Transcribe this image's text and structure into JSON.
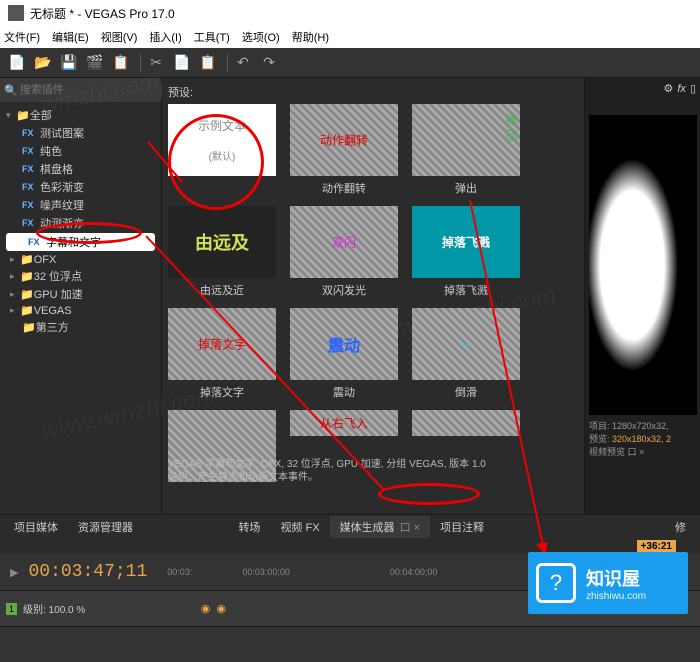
{
  "title": "无标题 * - VEGAS Pro 17.0",
  "menu": [
    "文件(F)",
    "编辑(E)",
    "视图(V)",
    "插入(I)",
    "工具(T)",
    "选项(O)",
    "帮助(H)"
  ],
  "search_placeholder": "搜索插件",
  "tree": {
    "all": "全部",
    "items": [
      "测试图案",
      "纯色",
      "棋盘格",
      "色彩渐变",
      "噪声纹理",
      "动测渐亦"
    ],
    "sel": "字幕和文字",
    "below": [
      "OFX",
      "32 位浮点",
      "GPU 加速",
      "VEGAS",
      "第三方"
    ]
  },
  "preset_label": "预设:",
  "presets": [
    {
      "label": "动作翻转",
      "txt": "动作翻转",
      "color": "#e20000",
      "sel": false,
      "first_label": "示例文本",
      "first_sub": "(默认)"
    },
    {
      "label": "弹出",
      "txt": "弹 回",
      "color": "#4caf50"
    },
    {
      "label": "由远及近",
      "txt": "由远及",
      "color": "#d4e157",
      "dark": true
    },
    {
      "label": "双闪发光",
      "txt": "双闪",
      "color": "#e91ee9"
    },
    {
      "label": "掉落飞溅",
      "txt": "掉落飞溅",
      "color": "#fff",
      "bg": "#0097a7"
    },
    {
      "label": "掉落文字",
      "txt": "掉落文字",
      "color": "#e20000"
    },
    {
      "label": "震动",
      "txt": "震动",
      "color": "#2962ff"
    },
    {
      "label": "倒滑",
      "txt": "—",
      "color": "#00e5ff"
    },
    {
      "label": "",
      "txt": "从右飞入",
      "color": "#e20000"
    }
  ],
  "desc_line1": "VEGAS 字幕和文字: OFX, 32 位浮点, GPU 加速, 分组 VEGAS, 版本 1.0",
  "desc_line2": "说明：产生静态和动画文本事件。",
  "tabs": {
    "left": [
      "项目媒体",
      "资源管理器"
    ],
    "center": [
      "转场",
      "视频 FX",
      "媒体生成器",
      "项目注释"
    ],
    "right": "修"
  },
  "info": {
    "line1": "项目: 1280x720x32,",
    "line2_a": "预览: ",
    "line2_b": "320x180x32, 2",
    "line3": "视频预览  口  ×"
  },
  "timecode": "00:03:47;11",
  "ruler": [
    "",
    "00:03:",
    "00:03:00;00",
    "",
    "00:04:00;00"
  ],
  "tc_badge": "+36:21",
  "level": "级别: 100.0 %",
  "badge": {
    "title": "知识屋",
    "url": "zhishiwu.com"
  }
}
